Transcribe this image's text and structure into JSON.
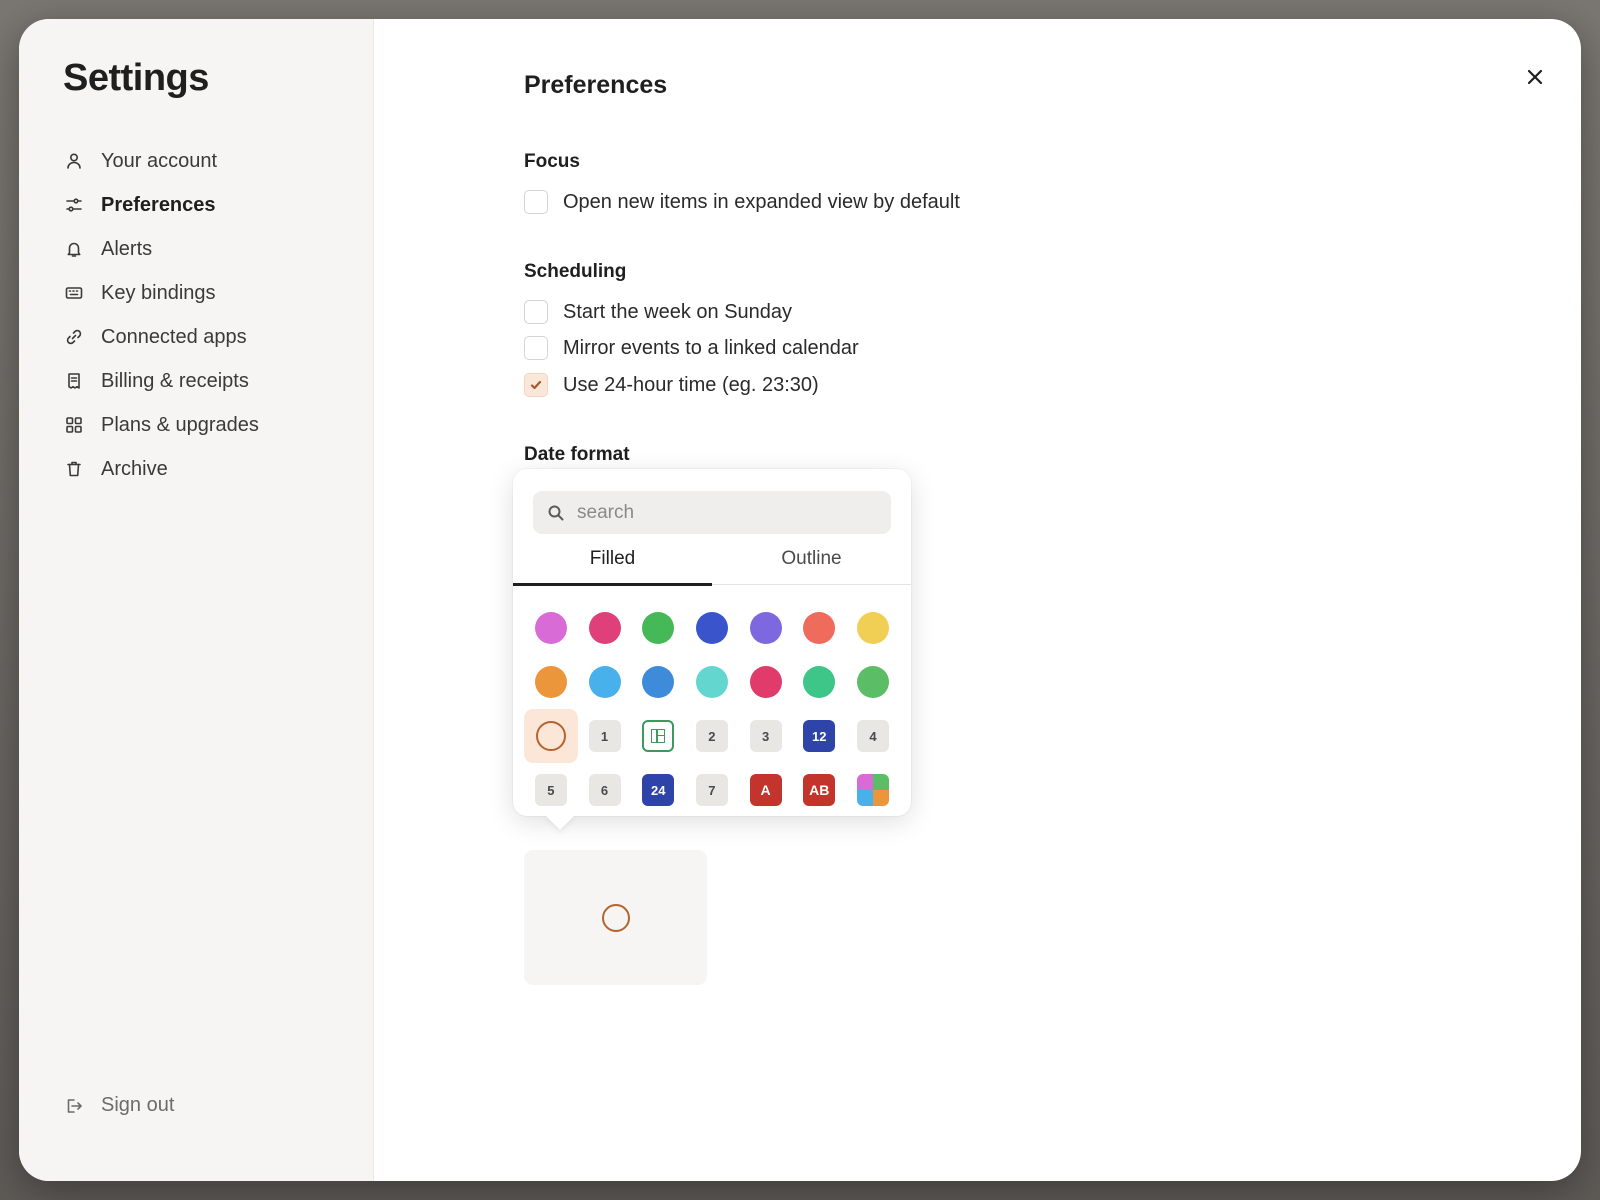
{
  "sidebar": {
    "title": "Settings",
    "items": [
      {
        "label": "Your account",
        "icon": "user-icon"
      },
      {
        "label": "Preferences",
        "icon": "sliders-icon",
        "active": true
      },
      {
        "label": "Alerts",
        "icon": "bell-icon"
      },
      {
        "label": "Key bindings",
        "icon": "keyboard-icon"
      },
      {
        "label": "Connected apps",
        "icon": "link-icon"
      },
      {
        "label": "Billing & receipts",
        "icon": "receipt-icon"
      },
      {
        "label": "Plans & upgrades",
        "icon": "grid-icon"
      },
      {
        "label": "Archive",
        "icon": "trash-icon"
      }
    ],
    "signout_label": "Sign out"
  },
  "main": {
    "title": "Preferences",
    "focus": {
      "title": "Focus",
      "options": [
        {
          "label": "Open new items in expanded view by default",
          "checked": false
        }
      ]
    },
    "scheduling": {
      "title": "Scheduling",
      "options": [
        {
          "label": "Start the week on Sunday",
          "checked": false
        },
        {
          "label": "Mirror events to a linked calendar",
          "checked": false
        },
        {
          "label": "Use 24-hour time (eg. 23:30)",
          "checked": true
        }
      ]
    },
    "date_format": {
      "title": "Date format"
    }
  },
  "picker": {
    "search_placeholder": "search",
    "tabs": [
      {
        "label": "Filled",
        "active": true
      },
      {
        "label": "Outline",
        "active": false
      }
    ],
    "colors_row1": [
      "#d96bd6",
      "#e0407a",
      "#45b857",
      "#3a55cc",
      "#7e68e0",
      "#ef6c5c",
      "#f1cf55"
    ],
    "colors_row2": [
      "#eb963a",
      "#48b0ea",
      "#3d8bd9",
      "#62d6cf",
      "#e03b6a",
      "#3ec588",
      "#5bbd66"
    ],
    "badges_row3": [
      "",
      "1",
      "",
      "2",
      "3",
      "12",
      "4"
    ],
    "badges_row4": [
      "5",
      "6",
      "24",
      "7",
      "A",
      "AB",
      ""
    ],
    "selected_color": "#b3652f"
  }
}
